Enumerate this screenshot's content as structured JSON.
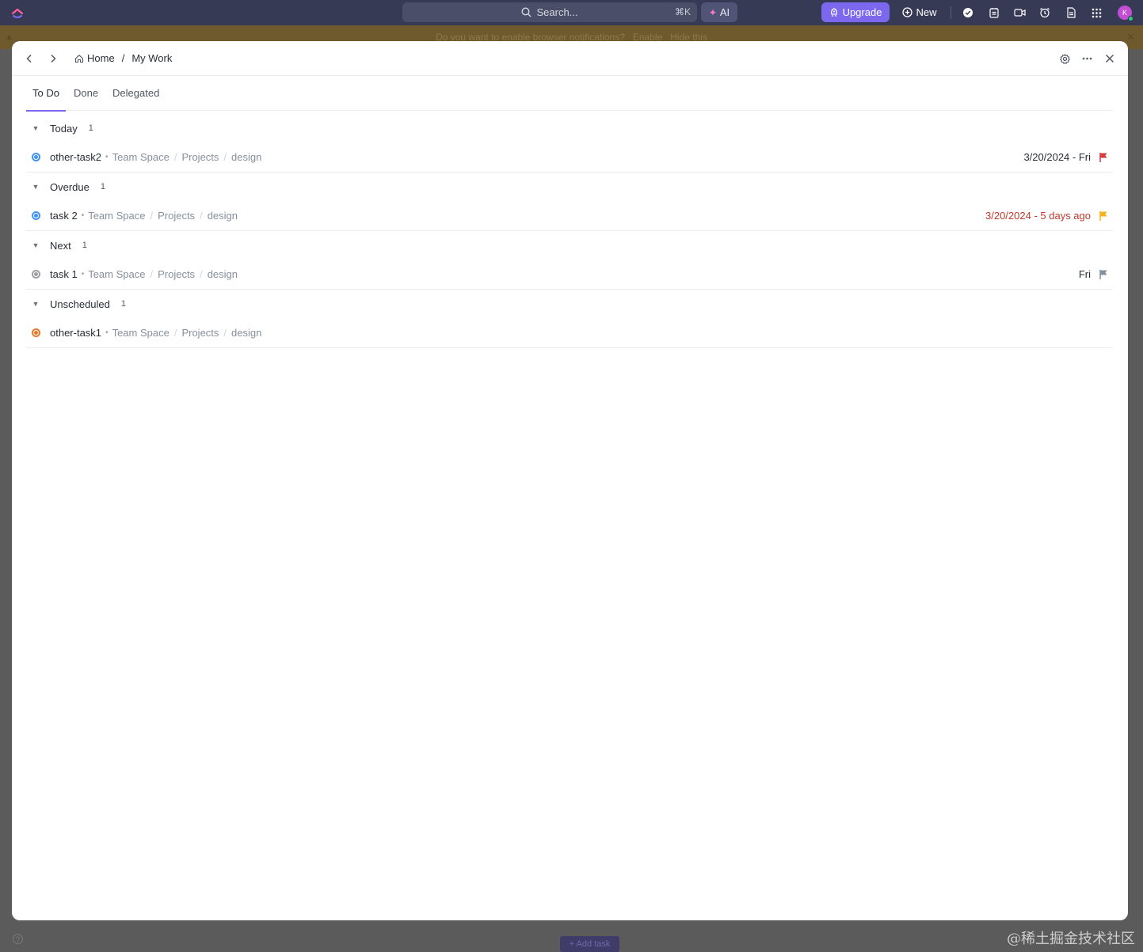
{
  "topbar": {
    "search_placeholder": "Search...",
    "search_shortcut": "⌘K",
    "ai_label": "AI",
    "upgrade_label": "Upgrade",
    "new_label": "New",
    "avatar_initial": "K",
    "icons": [
      "check-circle-icon",
      "notepad-icon",
      "video-icon",
      "alarm-icon",
      "document-icon",
      "apps-grid-icon"
    ]
  },
  "notification": {
    "message": "Do you want to enable browser notifications?",
    "enable_label": "Enable",
    "hide_label": "Hide this"
  },
  "background": {
    "add_task_label": "+ Add task"
  },
  "watermark": "@稀土掘金技术社区",
  "modal": {
    "breadcrumb": {
      "home_label": "Home",
      "separator": "/",
      "current_label": "My Work"
    },
    "tabs": [
      {
        "label": "To Do",
        "active": true
      },
      {
        "label": "Done",
        "active": false
      },
      {
        "label": "Delegated",
        "active": false
      }
    ],
    "groups": [
      {
        "label": "Today",
        "count": "1",
        "tasks": [
          {
            "name": "other-task2",
            "space": "Team Space",
            "folder": "Projects",
            "list": "design",
            "due": "3/20/2024 - Fri",
            "overdue": false,
            "status_color": "#4194f6",
            "flag_color": "#d33d44"
          }
        ]
      },
      {
        "label": "Overdue",
        "count": "1",
        "tasks": [
          {
            "name": "task 2",
            "space": "Team Space",
            "folder": "Projects",
            "list": "design",
            "due": "3/20/2024 - 5 days ago",
            "overdue": true,
            "status_color": "#4194f6",
            "flag_color": "#f5b31b"
          }
        ]
      },
      {
        "label": "Next",
        "count": "1",
        "tasks": [
          {
            "name": "task 1",
            "space": "Team Space",
            "folder": "Projects",
            "list": "design",
            "due": "Fri",
            "overdue": false,
            "status_color": "#9ea0a6",
            "flag_color": "#87909e"
          }
        ]
      },
      {
        "label": "Unscheduled",
        "count": "1",
        "tasks": [
          {
            "name": "other-task1",
            "space": "Team Space",
            "folder": "Projects",
            "list": "design",
            "due": "",
            "overdue": false,
            "status_color": "#e8792b",
            "flag_color": ""
          }
        ]
      }
    ]
  }
}
